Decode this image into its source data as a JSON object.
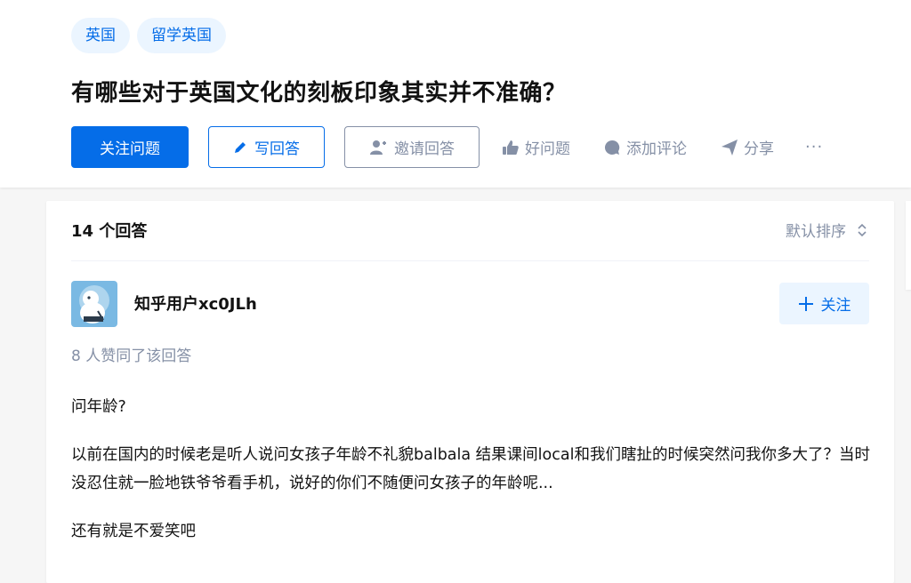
{
  "topics": [
    "英国",
    "留学英国"
  ],
  "question": {
    "title": "有哪些对于英国文化的刻板印象其实并不准确？"
  },
  "actions": {
    "follow_question": "关注问题",
    "write_answer": "写回答",
    "invite_answer": "邀请回答",
    "good_question": "好问题",
    "add_comment": "添加评论",
    "share": "分享",
    "more": "···"
  },
  "answers": {
    "count_label": "14 个回答",
    "sort_label": "默认排序"
  },
  "answer": {
    "author": "知乎用户xc0JLh",
    "follow_label": "关注",
    "votes": "8 人赞同了该回答",
    "paragraphs": [
      "问年龄?",
      "以前在国内的时候老是听人说问女孩子年龄不礼貌balbala 结果课间local和我们瞎扯的时候突然问我你多大了？当时没忍住就一脸地铁爷爷看手机，说好的你们不随便问女孩子的年龄呢...",
      "还有就是不爱笑吧"
    ]
  },
  "colors": {
    "brand": "#056de8",
    "muted": "#8590a6",
    "tag_bg": "#ebf5ff"
  }
}
